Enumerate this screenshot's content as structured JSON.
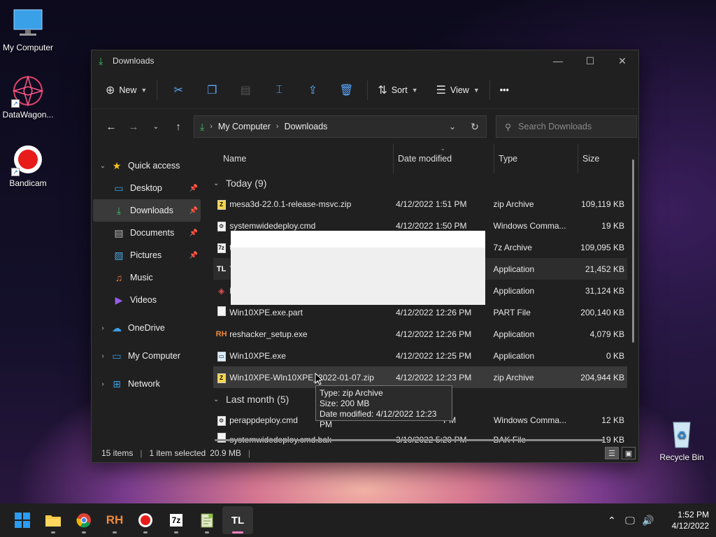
{
  "desktop": {
    "icons": [
      {
        "label": "My Computer"
      },
      {
        "label": "DataWagon..."
      },
      {
        "label": "Bandicam"
      },
      {
        "label": "Recycle Bin"
      }
    ]
  },
  "window": {
    "title": "Downloads",
    "controls": {
      "minimize": "—",
      "maximize": "☐",
      "close": "✕"
    }
  },
  "toolbar": {
    "new_label": "New",
    "sort_label": "Sort",
    "view_label": "View",
    "more_label": "•••"
  },
  "address": {
    "crumbs": [
      "My Computer",
      "Downloads"
    ],
    "search_placeholder": "Search Downloads"
  },
  "nav": {
    "quick_access": "Quick access",
    "items": [
      {
        "label": "Desktop",
        "pinned": true
      },
      {
        "label": "Downloads",
        "pinned": true
      },
      {
        "label": "Documents",
        "pinned": true
      },
      {
        "label": "Pictures",
        "pinned": true
      },
      {
        "label": "Music",
        "pinned": false
      },
      {
        "label": "Videos",
        "pinned": false
      }
    ],
    "onedrive": "OneDrive",
    "my_computer": "My Computer",
    "network": "Network"
  },
  "columns": {
    "name": "Name",
    "date": "Date modified",
    "type": "Type",
    "size": "Size"
  },
  "groups": {
    "today": "Today (9)",
    "last_month": "Last month (5)"
  },
  "files_today": [
    {
      "name": "mesa3d-22.0.1-release-msvc.zip",
      "date": "4/12/2022 1:51 PM",
      "type": "zip Archive",
      "size": "109,119 KB",
      "icon": "zip-icon"
    },
    {
      "name": "systemwidedeploy.cmd",
      "date": "4/12/2022 1:50 PM",
      "type": "Windows Comma...",
      "size": "19 KB",
      "icon": "cmd-icon"
    },
    {
      "name": "t",
      "date": "",
      "type": "7z Archive",
      "size": "109,095 KB",
      "icon": "7z-icon"
    },
    {
      "name": "T",
      "date": "",
      "type": "Application",
      "size": "21,452 KB",
      "icon": "tl-app-icon"
    },
    {
      "name": "E",
      "date": "",
      "type": "Application",
      "size": "31,124 KB",
      "icon": "installer-icon"
    },
    {
      "name": "Win10XPE.exe.part",
      "date": "4/12/2022 12:26 PM",
      "type": "PART File",
      "size": "200,140 KB",
      "icon": "file-icon"
    },
    {
      "name": "reshacker_setup.exe",
      "date": "4/12/2022 12:26 PM",
      "type": "Application",
      "size": "4,079 KB",
      "icon": "rh-icon"
    },
    {
      "name": "Win10XPE.exe",
      "date": "4/12/2022 12:25 PM",
      "type": "Application",
      "size": "0 KB",
      "icon": "exe-icon"
    },
    {
      "name": "Win10XPE-Wln10XPE_2022-01-07.zip",
      "date": "4/12/2022 12:23 PM",
      "type": "zip Archive",
      "size": "204,944 KB",
      "icon": "zip-icon"
    }
  ],
  "files_last_month": [
    {
      "name": "perappdeploy.cmd",
      "date": "PM",
      "type": "Windows Comma...",
      "size": "12 KB",
      "icon": "cmd-icon"
    },
    {
      "name": "systemwidedeploy.cmd.bak",
      "date": "3/10/2022 5:20 PM",
      "type": "BAK File",
      "size": "19 KB",
      "icon": "file-icon"
    }
  ],
  "tooltip": {
    "type": "Type: zip Archive",
    "size": "Size: 200 MB",
    "date": "Date modified: 4/12/2022 12:23 PM"
  },
  "status": {
    "items": "15 items",
    "selected": "1 item selected",
    "selected_size": "20.9 MB",
    "trailing": "|"
  },
  "taskbar": {
    "apps": [
      "start",
      "file-explorer",
      "chrome",
      "reshacker",
      "bandicam",
      "7zip",
      "notepad-plus",
      "tl-app"
    ],
    "rh_label": "RH",
    "tl_label": "TL",
    "sevenzip_label": "7z",
    "time": "1:52 PM",
    "date": "4/12/2022"
  }
}
